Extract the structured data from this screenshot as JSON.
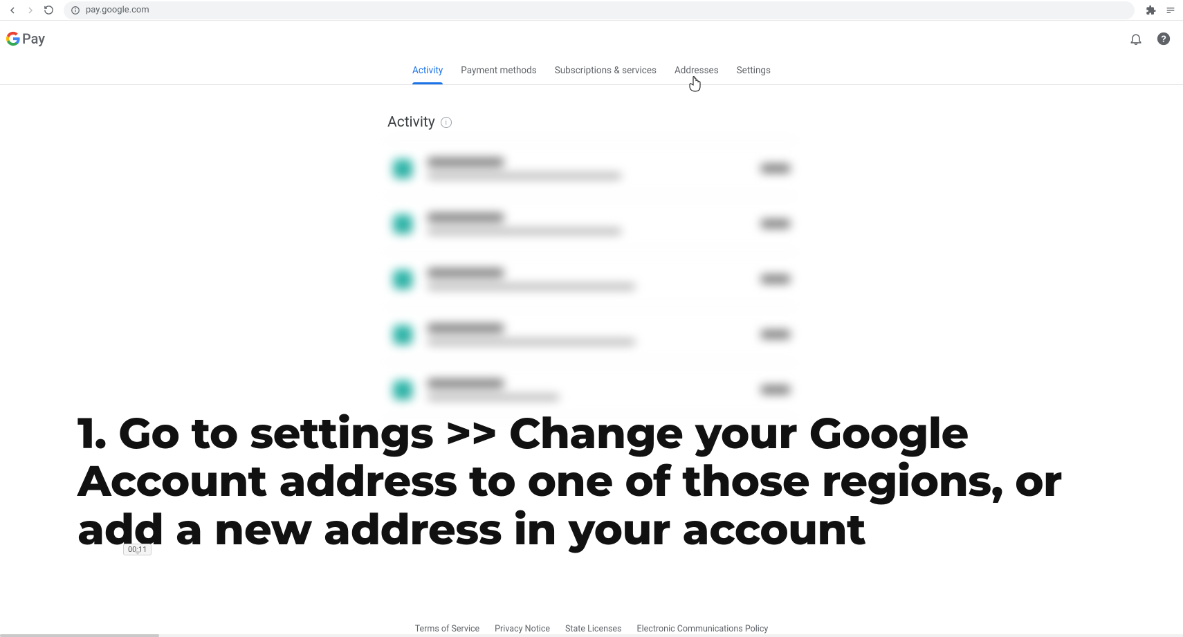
{
  "browser": {
    "url": "pay.google.com"
  },
  "brand": {
    "pay_word": "Pay"
  },
  "tabs": [
    {
      "label": "Activity",
      "active": true
    },
    {
      "label": "Payment methods",
      "active": false
    },
    {
      "label": "Subscriptions & services",
      "active": false
    },
    {
      "label": "Addresses",
      "active": false
    },
    {
      "label": "Settings",
      "active": false
    }
  ],
  "section": {
    "title": "Activity",
    "info_glyph": "i"
  },
  "activity_rows_count": 5,
  "overlay": {
    "caption": "1. Go to settings >> Change your Google Account address to one of those regions, or add a new address in your account",
    "timestamp": "00:11"
  },
  "footer": [
    "Terms of Service",
    "Privacy Notice",
    "State Licenses",
    "Electronic Communications Policy"
  ]
}
